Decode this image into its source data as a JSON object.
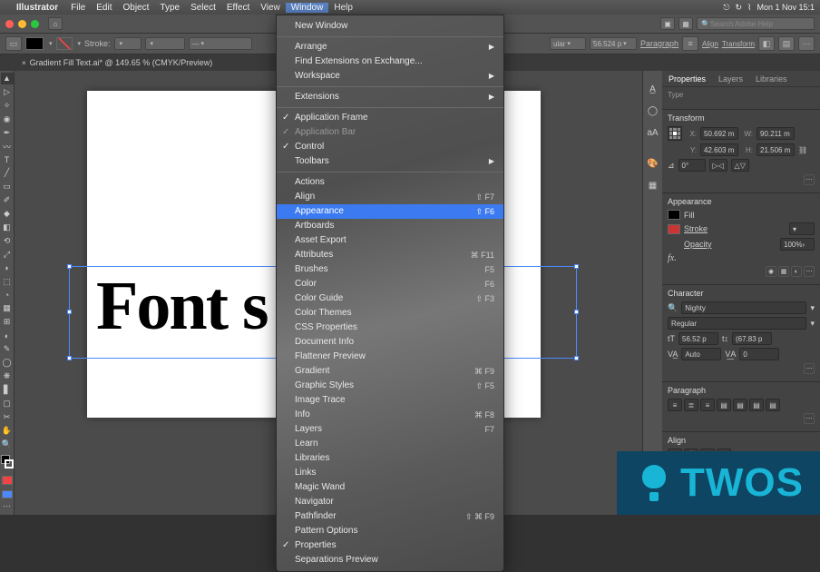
{
  "menubar": {
    "app": "Illustrator",
    "items": [
      "File",
      "Edit",
      "Object",
      "Type",
      "Select",
      "Effect",
      "View"
    ],
    "window": "Window",
    "help": "Help",
    "date": "Mon 1 Nov  15:1"
  },
  "search_placeholder": "Search Adobe Help",
  "control": {
    "stroke_label": "Stroke:",
    "stroke_val": "",
    "zoom": "56.524 p",
    "para": "Paragraph",
    "align": "Align",
    "transform": "Transform",
    "style_sel": "ular"
  },
  "doc_tab": "Gradient Fill Text.ai* @ 149.65 % (CMYK/Preview)",
  "canvas_text": "Font            s",
  "window_menu": {
    "new_window": "New Window",
    "arrange": "Arrange",
    "find_ext": "Find Extensions on Exchange...",
    "workspace": "Workspace",
    "extensions": "Extensions",
    "app_frame": "Application Frame",
    "app_bar": "Application Bar",
    "control": "Control",
    "toolbars": "Toolbars",
    "actions": "Actions",
    "align": "Align",
    "appearance": "Appearance",
    "artboards": "Artboards",
    "asset_export": "Asset Export",
    "attributes": "Attributes",
    "brushes": "Brushes",
    "color": "Color",
    "color_guide": "Color Guide",
    "color_themes": "Color Themes",
    "css_props": "CSS Properties",
    "doc_info": "Document Info",
    "flattener": "Flattener Preview",
    "gradient": "Gradient",
    "graphic_styles": "Graphic Styles",
    "image_trace": "Image Trace",
    "info": "Info",
    "layers": "Layers",
    "learn": "Learn",
    "libraries": "Libraries",
    "links": "Links",
    "magic_wand": "Magic Wand",
    "navigator": "Navigator",
    "pathfinder": "Pathfinder",
    "pattern_opts": "Pattern Options",
    "properties": "Properties",
    "sep_preview": "Separations Preview",
    "sc_align": "⇧ F7",
    "sc_appearance": "⇧ F6",
    "sc_attributes": "⌘ F11",
    "sc_brushes": "F5",
    "sc_color": "F6",
    "sc_colorguide": "⇧ F3",
    "sc_gradient": "⌘ F9",
    "sc_graphicstyles": "⇧ F5",
    "sc_info": "⌘ F8",
    "sc_layers": "F7",
    "sc_pathfinder": "⇧ ⌘ F9"
  },
  "panels": {
    "tabs": {
      "properties": "Properties",
      "layers": "Layers",
      "libraries": "Libraries"
    },
    "type_label": "Type",
    "transform": {
      "title": "Transform",
      "x_label": "X:",
      "x": "50.692 m",
      "y_label": "Y:",
      "y": "42.603 m",
      "w_label": "W:",
      "w": "90.211 m",
      "h_label": "H:",
      "h": "21.506 m",
      "rot": "0°",
      "flip": "▷◁"
    },
    "appearance": {
      "title": "Appearance",
      "fill": "Fill",
      "stroke": "Stroke",
      "opacity_label": "Opacity",
      "opacity": "100%",
      "fx": "fx."
    },
    "character": {
      "title": "Character",
      "font": "Nighty",
      "weight": "Regular",
      "size": "56.52 p",
      "leading": "(67.83 p",
      "kerning": "Auto",
      "tracking": "0"
    },
    "paragraph": {
      "title": "Paragraph"
    },
    "align": {
      "title": "Align"
    }
  },
  "watermark": "TWOS"
}
